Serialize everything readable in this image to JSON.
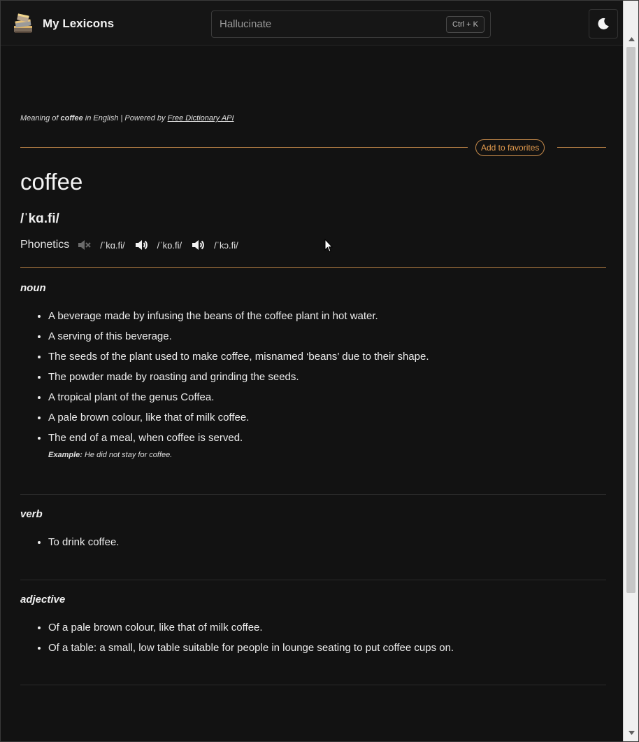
{
  "header": {
    "title": "My Lexicons",
    "search_placeholder": "Hallucinate",
    "search_shortcut": "Ctrl + K",
    "theme_icon": "moon-icon"
  },
  "source": {
    "prefix": "Meaning of",
    "word": "coffee",
    "middle": "in English | Powered by",
    "link_text": "Free Dictionary API"
  },
  "favorites_label": "Add to favorites",
  "entry": {
    "word": "coffee",
    "phonetic": "/ˈkɑ.fi/",
    "phonetics_label": "Phonetics",
    "phonetics": [
      {
        "icon": "speaker-muted-icon",
        "text": "/ˈkɑ.fi/"
      },
      {
        "icon": "speaker-icon",
        "text": "/ˈkɒ.fi/"
      },
      {
        "icon": "speaker-icon",
        "text": "/ˈkɔ.fi/"
      }
    ]
  },
  "meanings": [
    {
      "part_of_speech": "noun",
      "definitions": [
        "A beverage made by infusing the beans of the coffee plant in hot water.",
        "A serving of this beverage.",
        "The seeds of the plant used to make coffee, misnamed ‘beans’ due to their shape.",
        "The powder made by roasting and grinding the seeds.",
        "A tropical plant of the genus Coffea.",
        "A pale brown colour, like that of milk coffee.",
        "The end of a meal, when coffee is served."
      ],
      "example_label": "Example:",
      "example": "He did not stay for coffee."
    },
    {
      "part_of_speech": "verb",
      "definitions": [
        "To drink coffee."
      ]
    },
    {
      "part_of_speech": "adjective",
      "definitions": [
        "Of a pale brown colour, like that of milk coffee.",
        "Of a table: a small, low table suitable for people in lounge seating to put coffee cups on."
      ]
    }
  ],
  "colors": {
    "background": "#121212",
    "accent": "#e39b4e",
    "accent_line": "#c58a4a",
    "text": "#ededed"
  }
}
